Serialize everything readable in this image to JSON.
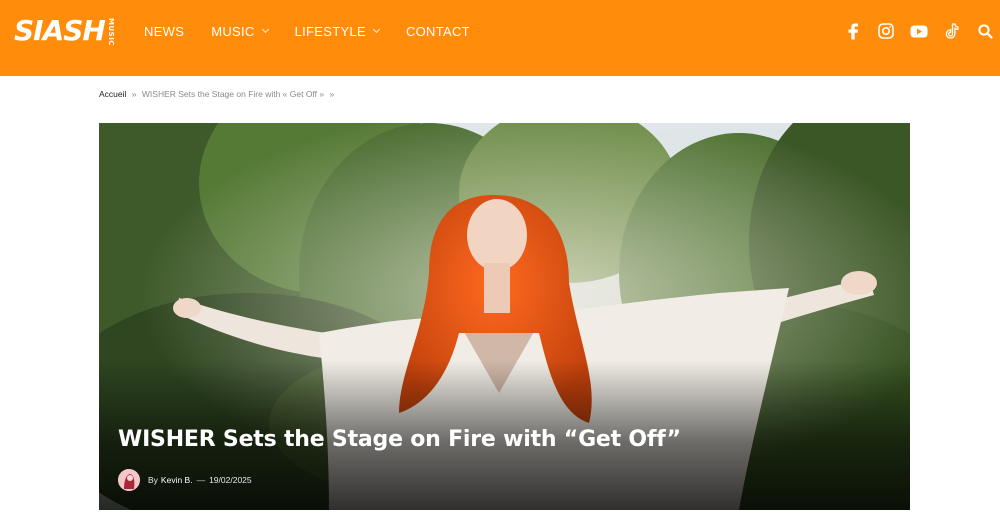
{
  "header": {
    "logo_main": "SIASH",
    "logo_sub": "MUSIC",
    "nav": [
      {
        "label": "NEWS",
        "dropdown": false
      },
      {
        "label": "MUSIC",
        "dropdown": true
      },
      {
        "label": "LIFESTYLE",
        "dropdown": true
      },
      {
        "label": "CONTACT",
        "dropdown": false
      }
    ],
    "social_icons": [
      "facebook-icon",
      "instagram-icon",
      "youtube-icon",
      "tiktok-icon",
      "search-icon"
    ],
    "accent_color": "#ff8c0a"
  },
  "breadcrumb": {
    "home": "Accueil",
    "separator": "»",
    "current": "WISHER Sets the Stage on Fire with « Get Off »",
    "trailing": "»"
  },
  "hero": {
    "title": "WISHER Sets the Stage on Fire with “Get Off”",
    "by": "By",
    "author": "Kevin B.",
    "dash": "—",
    "date": "19/02/2025"
  }
}
